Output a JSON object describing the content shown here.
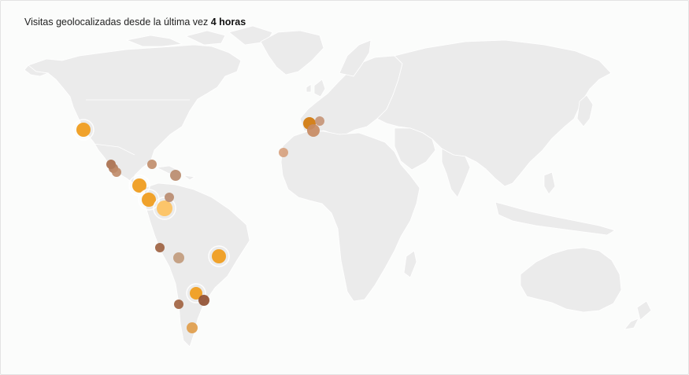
{
  "header": {
    "text": "Visitas geolocalizadas desde la última vez",
    "emphasis": "4 horas"
  },
  "markers": [
    {
      "place": "West Coast USA",
      "color": "#f0a22b",
      "level": 1.0
    },
    {
      "place": "Mexico 1",
      "color": "#a86d4a",
      "level": 0.6
    },
    {
      "place": "Mexico 2",
      "color": "#b07a5a",
      "level": 0.6
    },
    {
      "place": "Mexico 3",
      "color": "#bf8a67",
      "level": 0.6
    },
    {
      "place": "Honduras",
      "color": "#c08c69",
      "level": 0.6
    },
    {
      "place": "Cuba/Haiti",
      "color": "#b8886a",
      "level": 0.6
    },
    {
      "place": "Costa Rica",
      "color": "#f0a22b",
      "level": 1.0
    },
    {
      "place": "Panama",
      "color": "#f0a22b",
      "level": 1.0
    },
    {
      "place": "Colombia",
      "color": "#fcc56a",
      "level": 1.0
    },
    {
      "place": "Venezuela",
      "color": "#b88a6e",
      "level": 0.6
    },
    {
      "place": "Peru",
      "color": "#9c5f3e",
      "level": 0.6
    },
    {
      "place": "Bolivia",
      "color": "#c19a7b",
      "level": 0.6
    },
    {
      "place": "Brazil",
      "color": "#f0a22b",
      "level": 1.0
    },
    {
      "place": "Paraguay/N.Argentina",
      "color": "#f0a22b",
      "level": 1.0
    },
    {
      "place": "Uruguay",
      "color": "#8f4d2e",
      "level": 0.6
    },
    {
      "place": "Chile",
      "color": "#a0603e",
      "level": 0.6
    },
    {
      "place": "Patagonia",
      "color": "#e0a050",
      "level": 0.8
    },
    {
      "place": "Spain",
      "color": "#d4821d",
      "level": 1.0
    },
    {
      "place": "Spain South",
      "color": "#c78a62",
      "level": 0.7
    },
    {
      "place": "France/Italy",
      "color": "#c59476",
      "level": 0.6
    },
    {
      "place": "Canary Islands",
      "color": "#d6a07c",
      "level": 0.6
    }
  ]
}
